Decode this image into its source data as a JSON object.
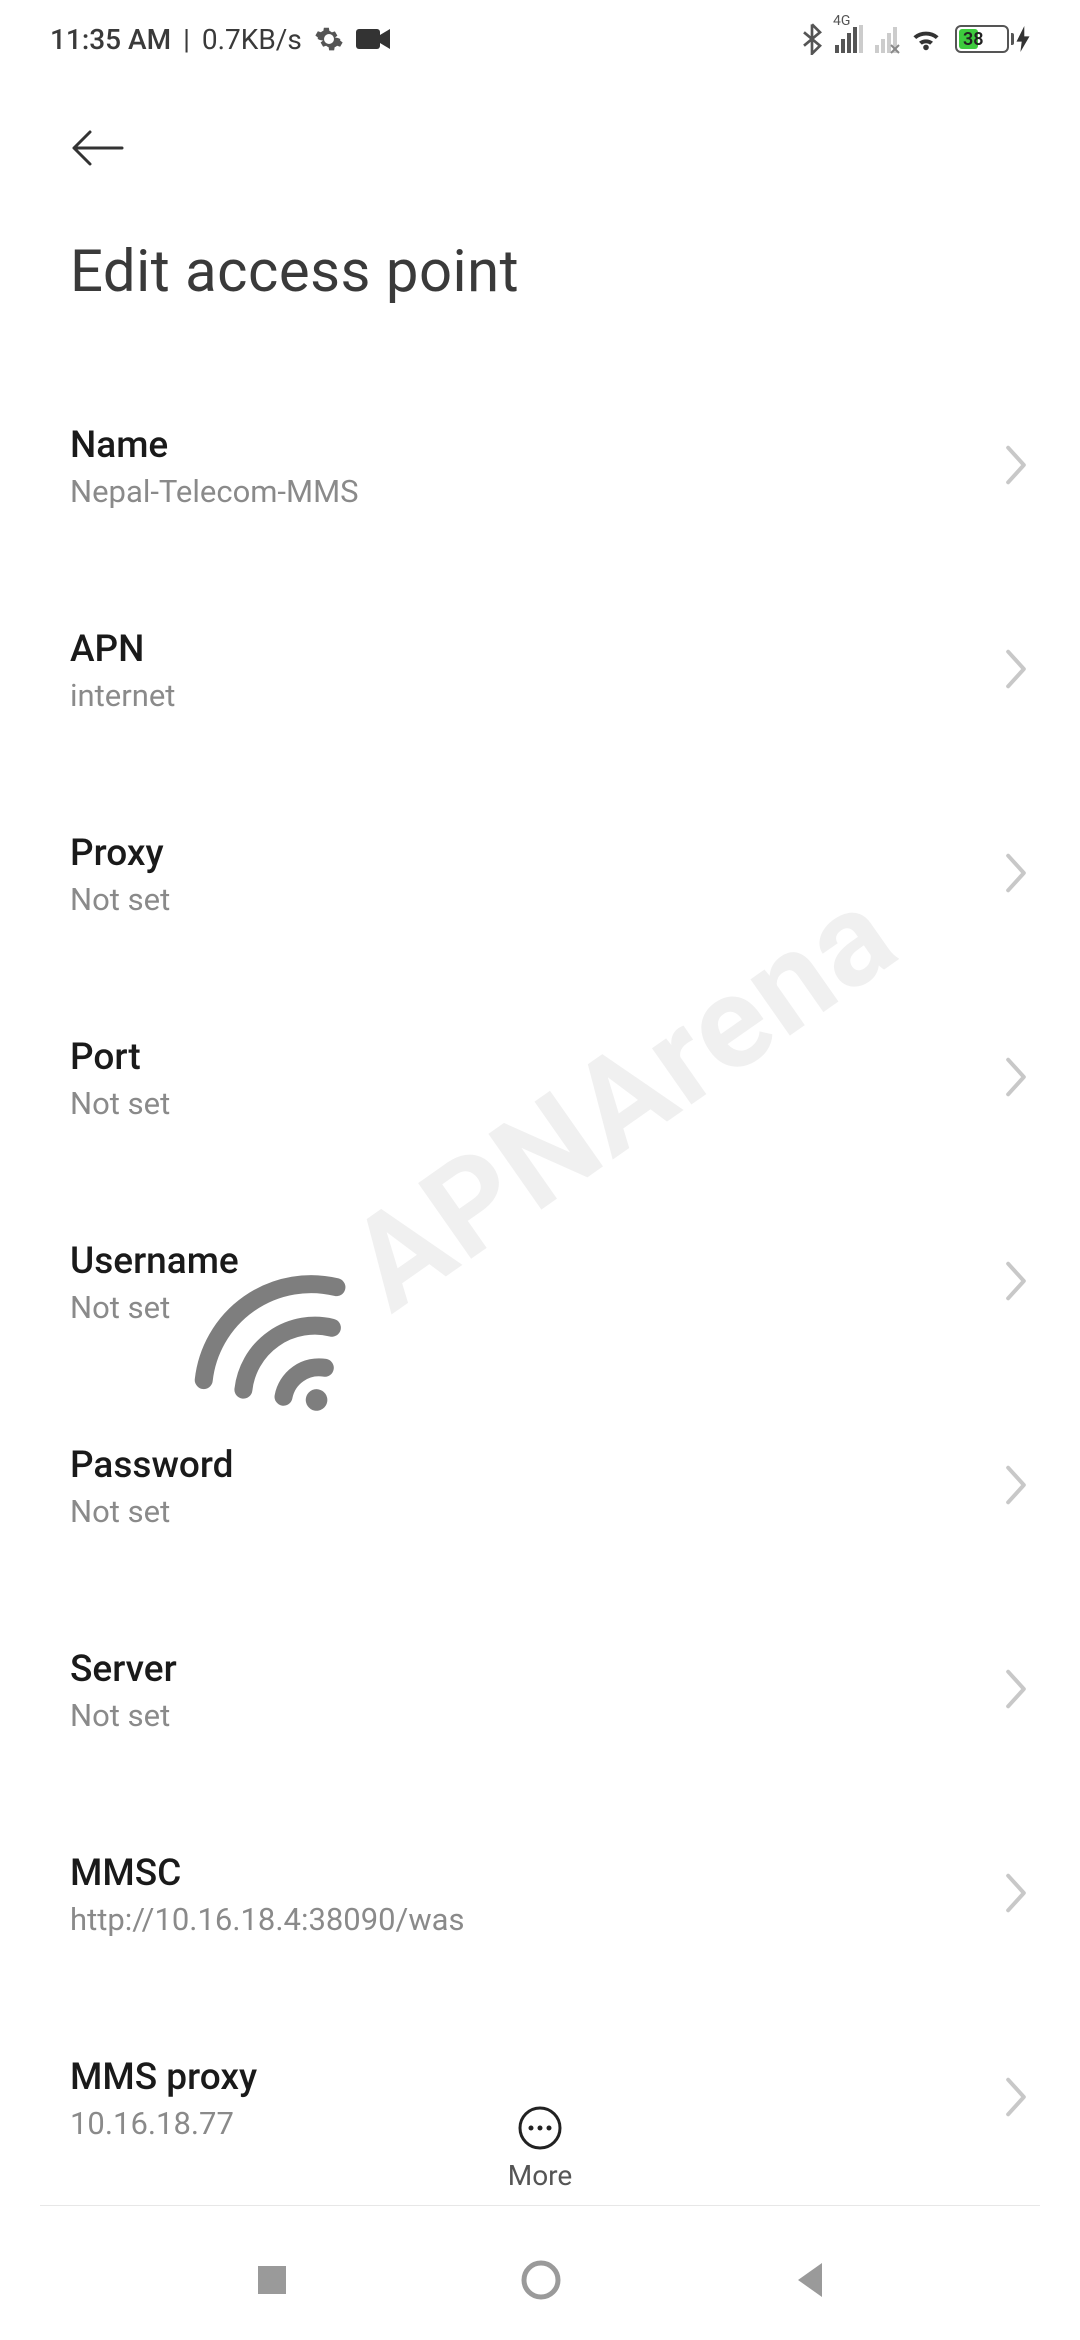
{
  "statusbar": {
    "time": "11:35 AM",
    "speed": "0.7KB/s",
    "network_badge": "4G",
    "battery_pct": "38"
  },
  "header": {
    "title": "Edit access point"
  },
  "settings": [
    {
      "label": "Name",
      "value": "Nepal-Telecom-MMS"
    },
    {
      "label": "APN",
      "value": "internet"
    },
    {
      "label": "Proxy",
      "value": "Not set"
    },
    {
      "label": "Port",
      "value": "Not set"
    },
    {
      "label": "Username",
      "value": "Not set"
    },
    {
      "label": "Password",
      "value": "Not set"
    },
    {
      "label": "Server",
      "value": "Not set"
    },
    {
      "label": "MMSC",
      "value": "http://10.16.18.4:38090/was"
    },
    {
      "label": "MMS proxy",
      "value": "10.16.18.77"
    }
  ],
  "footer": {
    "more_label": "More"
  },
  "watermark": "APNArena"
}
